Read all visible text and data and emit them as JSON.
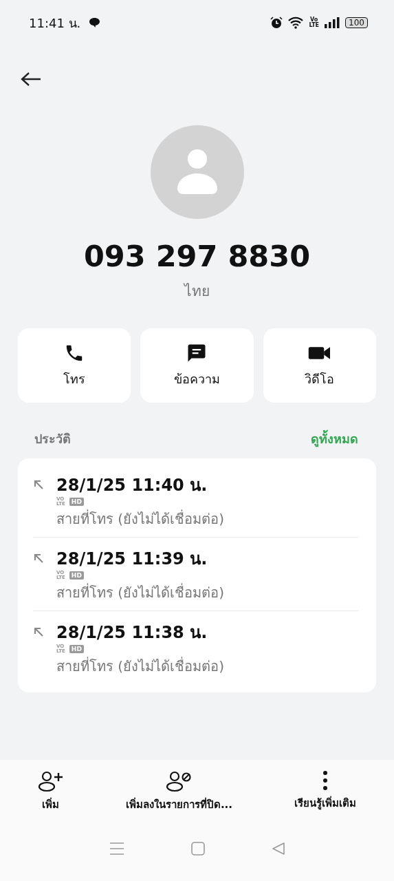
{
  "status_bar": {
    "time": "11:41 น.",
    "volte": [
      "Vo",
      "LTE"
    ],
    "battery": "100"
  },
  "contact": {
    "number": "093 297 8830",
    "region": "ไทย"
  },
  "actions": [
    {
      "kind": "call",
      "label": "โทร"
    },
    {
      "kind": "message",
      "label": "ข้อความ"
    },
    {
      "kind": "video",
      "label": "วิดีโอ"
    }
  ],
  "history": {
    "title": "ประวัติ",
    "see_all": "ดูทั้งหมด",
    "calls": [
      {
        "time": "28/1/25 11:40 น.",
        "badges": [
          "VO",
          "LTE",
          "HD"
        ],
        "status": "สายที่โทร (ยังไม่ได้เชื่อมต่อ)"
      },
      {
        "time": "28/1/25 11:39 น.",
        "badges": [
          "VO",
          "LTE",
          "HD"
        ],
        "status": "สายที่โทร (ยังไม่ได้เชื่อมต่อ)"
      },
      {
        "time": "28/1/25 11:38 น.",
        "badges": [
          "VO",
          "LTE",
          "HD"
        ],
        "status": "สายที่โทร (ยังไม่ได้เชื่อมต่อ)"
      }
    ]
  },
  "bottom_actions": [
    {
      "kind": "add",
      "label": "เพิ่ม"
    },
    {
      "kind": "block",
      "label": "เพิ่มลงในรายการที่ปิด..."
    },
    {
      "kind": "more",
      "label": "เรียนรู้เพิ่มเติม"
    }
  ]
}
